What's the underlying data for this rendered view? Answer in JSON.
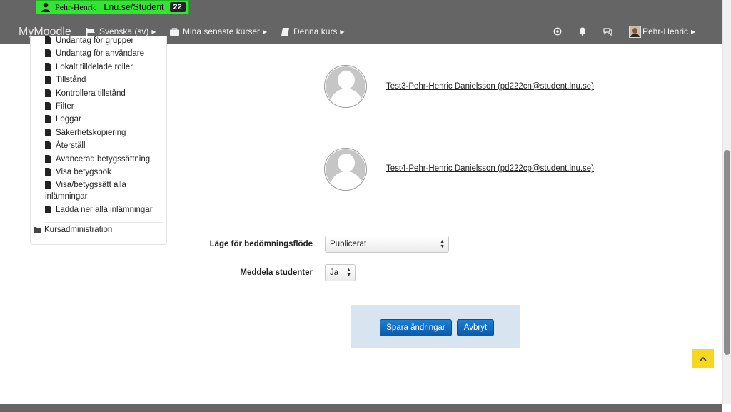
{
  "user_badge": {
    "name": "Pehr-Henric",
    "role": "Lnu.se/Student",
    "count": "22"
  },
  "navbar": {
    "brand": "MyMoodle",
    "items": [
      {
        "label": "Svenska (sv)",
        "icon": "flag-icon"
      },
      {
        "label": "Mina senaste kurser",
        "icon": "briefcase-icon"
      },
      {
        "label": "Denna kurs",
        "icon": "book-icon"
      }
    ],
    "user_name": "Pehr-Henric"
  },
  "sidebar": {
    "items": [
      "Undantag för grupper",
      "Undantag för användare",
      "Lokalt tilldelade roller",
      "Tillstånd",
      "Kontrollera tillstånd",
      "Filter",
      "Loggar",
      "Säkerhetskopiering",
      "Återställ",
      "Avancerad betygssättning",
      "Visa betygsbok",
      "Visa/betygssätt alla inlämningar",
      "Ladda ner alla inlämningar"
    ],
    "admin": "Kursadministration"
  },
  "users": [
    {
      "label": "Test3-Pehr-Henric Danielsson (pd222cn@student.lnu.se)"
    },
    {
      "label": "Test4-Pehr-Henric Danielsson (pd222cp@student.lnu.se)"
    }
  ],
  "form": {
    "workflow_label": "Läge för bedömningsflöde",
    "workflow_value": "Publicerat",
    "notify_label": "Meddela studenter",
    "notify_value": "Ja"
  },
  "actions": {
    "save": "Spara ändringar",
    "cancel": "Avbryt"
  },
  "colors": {
    "navbar": "#656565",
    "badge": "#33e533",
    "button": "#0f6cbf",
    "panel": "#d8e4ef",
    "back_to_top": "#f5d81f"
  }
}
